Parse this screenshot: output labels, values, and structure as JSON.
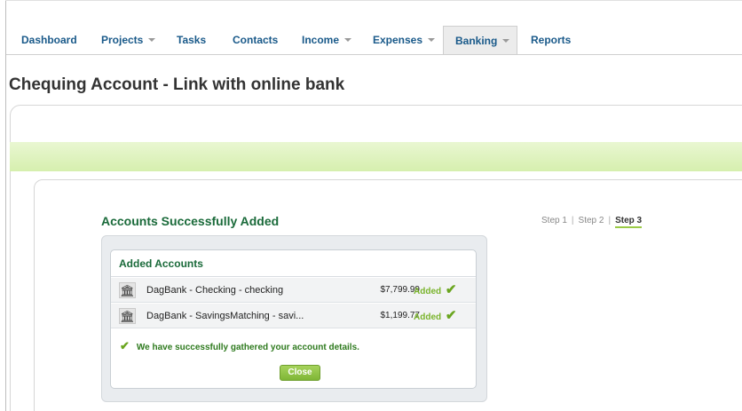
{
  "nav": {
    "items": [
      {
        "label": "Dashboard"
      },
      {
        "label": "Projects"
      },
      {
        "label": "Tasks"
      },
      {
        "label": "Contacts"
      },
      {
        "label": "Income"
      },
      {
        "label": "Expenses"
      },
      {
        "label": "Banking"
      },
      {
        "label": "Reports"
      }
    ],
    "active": "Banking"
  },
  "page": {
    "title": "Chequing Account - Link with online bank"
  },
  "wizard": {
    "heading": "Accounts Successfully Added",
    "steps": [
      "Step 1",
      "Step 2",
      "Step 3"
    ],
    "current_step": "Step 3"
  },
  "accounts_panel": {
    "header": "Added Accounts",
    "rows": [
      {
        "name": "DagBank - Checking - checking",
        "amount": "$7,799.99",
        "status": "Added",
        "icon": "bank-icon"
      },
      {
        "name": "DagBank - SavingsMatching - savi...",
        "amount": "$1,199.77",
        "status": "Added",
        "icon": "bank-icon"
      }
    ],
    "success_message": "We have successfully gathered your account details.",
    "close_label": "Close"
  },
  "colors": {
    "link": "#1a5a8a",
    "heading_green": "#1a6a3a",
    "accent_green": "#7fb636",
    "band": "#d6efae"
  }
}
